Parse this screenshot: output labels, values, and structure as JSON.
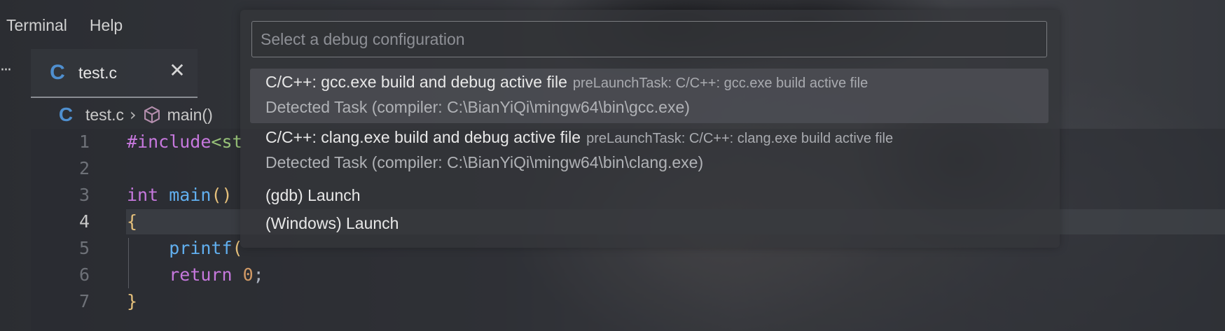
{
  "menubar": {
    "items": [
      {
        "label": "Terminal"
      },
      {
        "label": "Help"
      }
    ]
  },
  "tabs": {
    "more": "···",
    "active": {
      "icon": "C",
      "label": "test.c",
      "close": "✕"
    }
  },
  "breadcrumb": {
    "file_icon": "C",
    "file": "test.c",
    "separator": "›",
    "symbol": "main()"
  },
  "editor": {
    "active_line": 4,
    "lines": [
      {
        "num": "1",
        "tokens": [
          {
            "t": "#include",
            "c": "kw"
          },
          {
            "t": "<st",
            "c": "str"
          }
        ]
      },
      {
        "num": "2",
        "tokens": []
      },
      {
        "num": "3",
        "tokens": [
          {
            "t": "int",
            "c": "kw"
          },
          {
            "t": " ",
            "c": "plain"
          },
          {
            "t": "main",
            "c": "fn"
          },
          {
            "t": "()",
            "c": "brace"
          }
        ]
      },
      {
        "num": "4",
        "tokens": [
          {
            "t": "{",
            "c": "brace"
          }
        ]
      },
      {
        "num": "5",
        "tokens": [
          {
            "t": "    ",
            "c": "plain"
          },
          {
            "t": "printf",
            "c": "fn"
          },
          {
            "t": "(",
            "c": "brace"
          }
        ]
      },
      {
        "num": "6",
        "tokens": [
          {
            "t": "    ",
            "c": "plain"
          },
          {
            "t": "return",
            "c": "kw"
          },
          {
            "t": " ",
            "c": "plain"
          },
          {
            "t": "0",
            "c": "num"
          },
          {
            "t": ";",
            "c": "plain"
          }
        ]
      },
      {
        "num": "7",
        "tokens": [
          {
            "t": "}",
            "c": "brace"
          }
        ]
      }
    ]
  },
  "quickpick": {
    "placeholder": "Select a debug configuration",
    "value": "",
    "items": [
      {
        "label": "C/C++: gcc.exe build and debug active file",
        "description": "preLaunchTask: C/C++: gcc.exe build active file",
        "detail": "Detected Task (compiler: C:\\BianYiQi\\mingw64\\bin\\gcc.exe)",
        "selected": true
      },
      {
        "label": "C/C++: clang.exe build and debug active file",
        "description": "preLaunchTask: C/C++: clang.exe build active file",
        "detail": "Detected Task (compiler: C:\\BianYiQi\\mingw64\\bin\\clang.exe)",
        "selected": false
      },
      {
        "label": "(gdb) Launch",
        "selected": false
      },
      {
        "label": "(Windows) Launch",
        "selected": false
      }
    ]
  },
  "colors": {
    "keyword": "#c678dd",
    "function": "#61afef",
    "string": "#98c379",
    "number": "#d19a66",
    "brace": "#e5c07b",
    "c_icon": "#4f8fcf"
  }
}
